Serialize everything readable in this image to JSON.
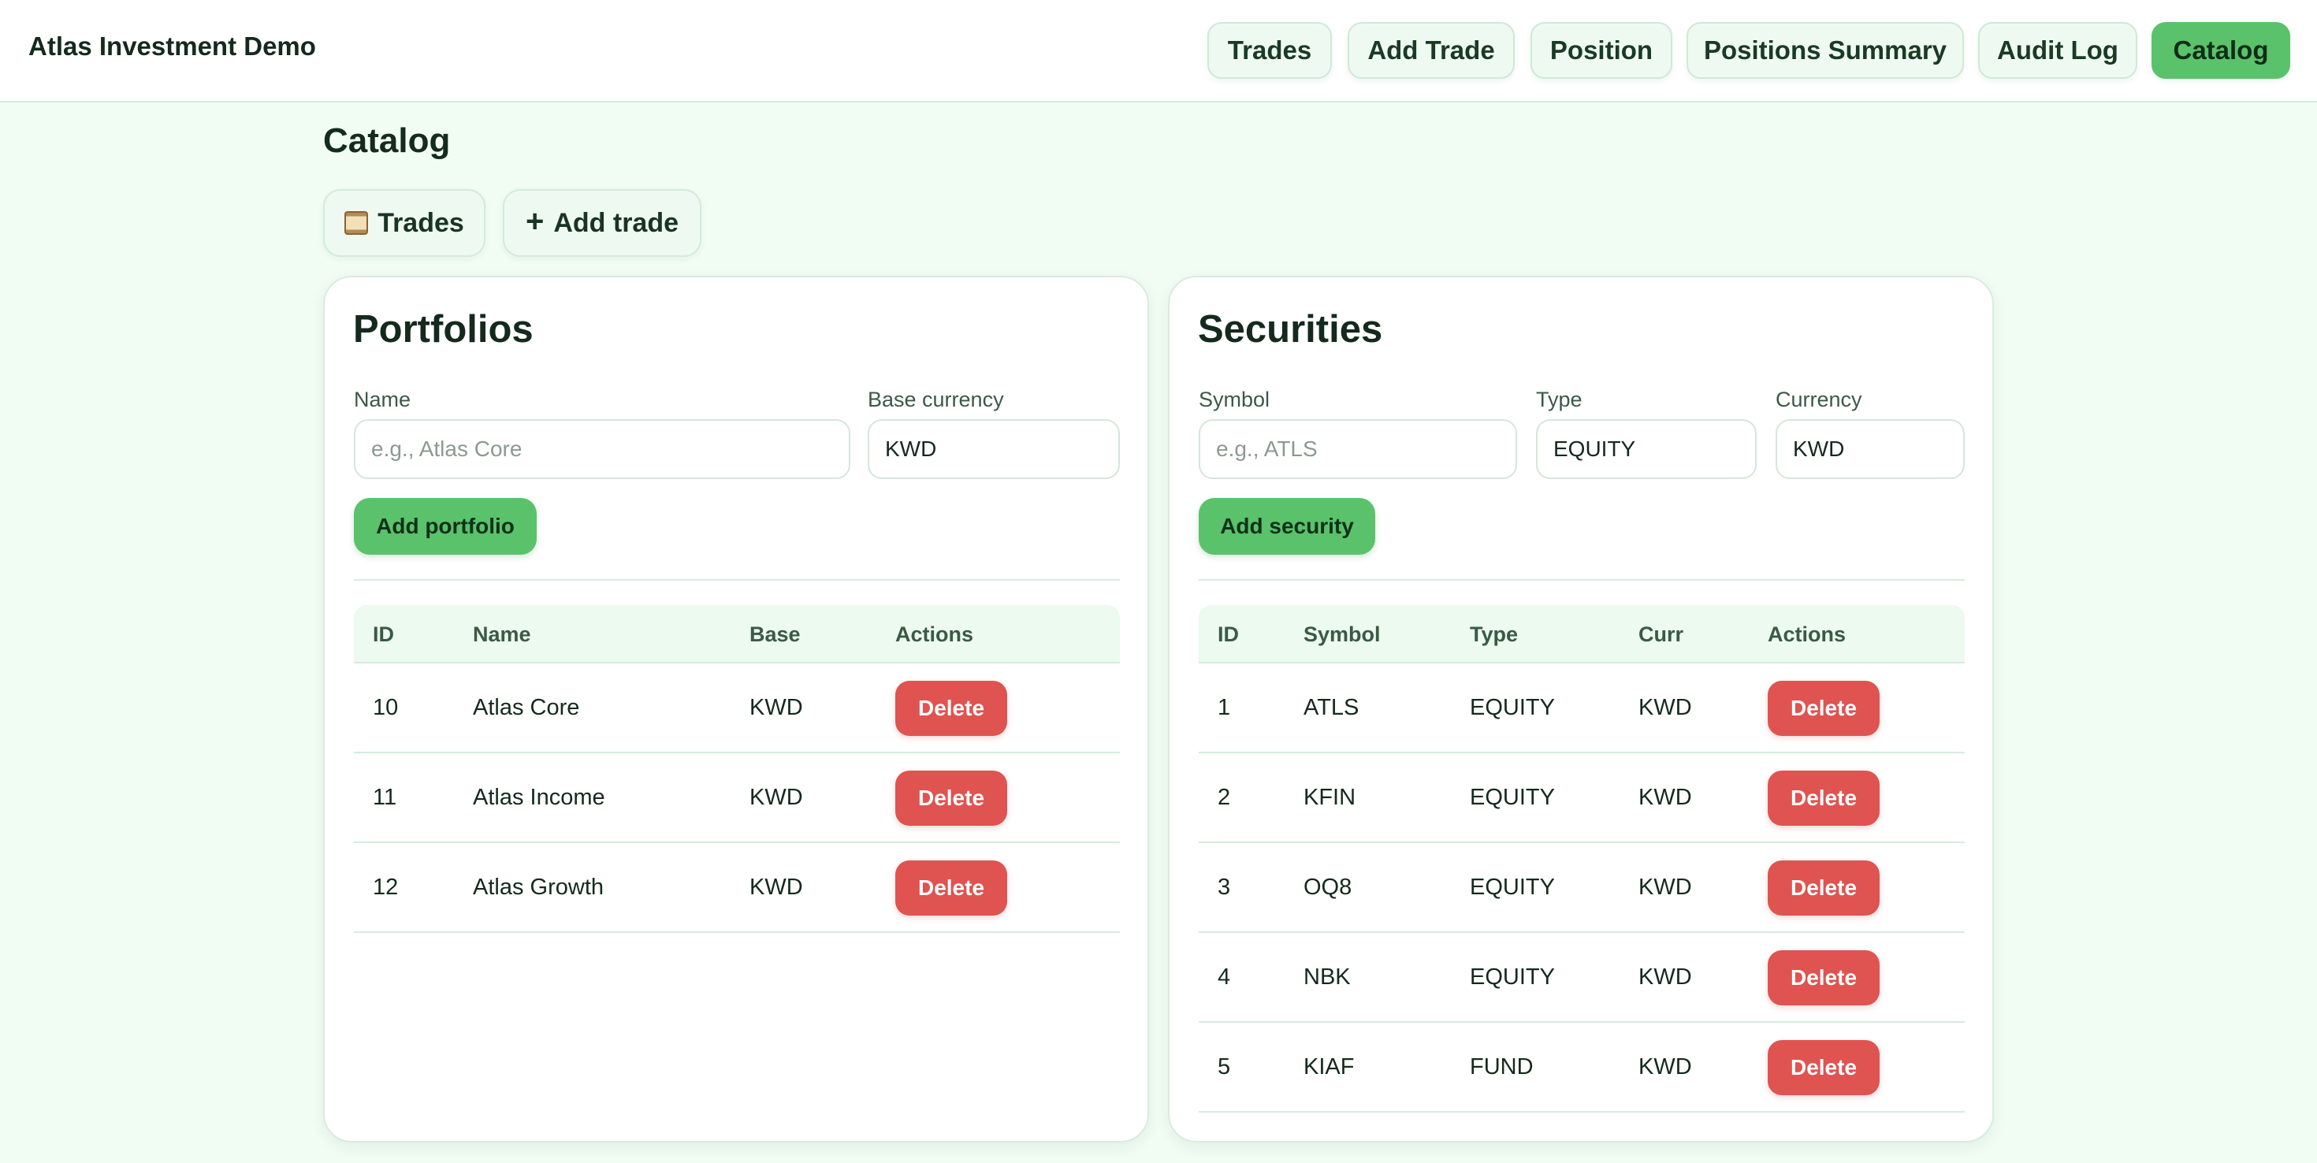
{
  "app": {
    "title": "Atlas Investment Demo"
  },
  "nav": {
    "items": [
      {
        "label": "Trades",
        "active": false
      },
      {
        "label": "Add Trade",
        "active": false
      },
      {
        "label": "Position",
        "active": false
      },
      {
        "label": "Positions Summary",
        "active": false
      },
      {
        "label": "Audit Log",
        "active": false
      },
      {
        "label": "Catalog",
        "active": true
      }
    ]
  },
  "page": {
    "title": "Catalog",
    "quick_actions": [
      {
        "label": "Trades",
        "icon": "scroll-icon"
      },
      {
        "label": "Add trade",
        "icon": "plus-icon"
      }
    ]
  },
  "portfolios": {
    "title": "Portfolios",
    "name_label": "Name",
    "name_placeholder": "e.g., Atlas Core",
    "name_value": "",
    "currency_label": "Base currency",
    "currency_value": "KWD",
    "add_label": "Add portfolio",
    "columns": [
      "ID",
      "Name",
      "Base",
      "Actions"
    ],
    "rows": [
      {
        "id": "10",
        "name": "Atlas Core",
        "base": "KWD",
        "action": "Delete"
      },
      {
        "id": "11",
        "name": "Atlas Income",
        "base": "KWD",
        "action": "Delete"
      },
      {
        "id": "12",
        "name": "Atlas Growth",
        "base": "KWD",
        "action": "Delete"
      }
    ]
  },
  "securities": {
    "title": "Securities",
    "symbol_label": "Symbol",
    "symbol_placeholder": "e.g., ATLS",
    "symbol_value": "",
    "type_label": "Type",
    "type_value": "EQUITY",
    "currency_label": "Currency",
    "currency_value": "KWD",
    "add_label": "Add security",
    "columns": [
      "ID",
      "Symbol",
      "Type",
      "Curr",
      "Actions"
    ],
    "rows": [
      {
        "id": "1",
        "symbol": "ATLS",
        "type": "EQUITY",
        "curr": "KWD",
        "action": "Delete"
      },
      {
        "id": "2",
        "symbol": "KFIN",
        "type": "EQUITY",
        "curr": "KWD",
        "action": "Delete"
      },
      {
        "id": "3",
        "symbol": "OQ8",
        "type": "EQUITY",
        "curr": "KWD",
        "action": "Delete"
      },
      {
        "id": "4",
        "symbol": "NBK",
        "type": "EQUITY",
        "curr": "KWD",
        "action": "Delete"
      },
      {
        "id": "5",
        "symbol": "KIAF",
        "type": "FUND",
        "curr": "KWD",
        "action": "Delete"
      }
    ]
  },
  "colors": {
    "accent": "#5ac26a",
    "danger": "#df5350",
    "page_bg": "#f1fcf3"
  }
}
